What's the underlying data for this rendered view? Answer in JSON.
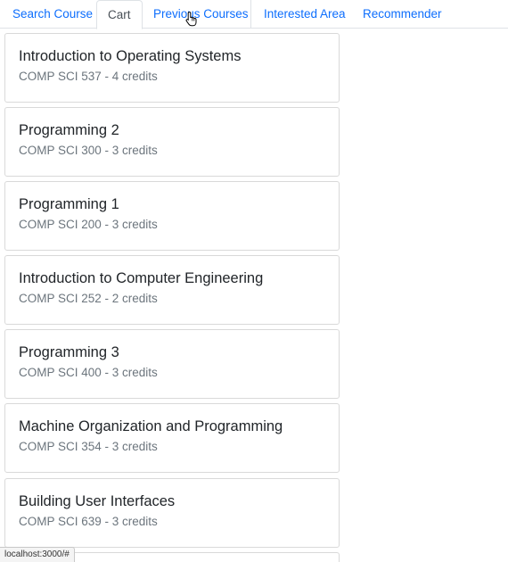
{
  "nav": {
    "tabs": [
      {
        "label": "Search Course"
      },
      {
        "label": "Cart"
      },
      {
        "label": "Previous Courses"
      },
      {
        "label": "Interested Area"
      },
      {
        "label": "Recommender"
      }
    ],
    "active_tab": "Cart"
  },
  "cart": {
    "courses": [
      {
        "name": "Introduction to Operating Systems",
        "details": "COMP SCI 537 - 4 credits"
      },
      {
        "name": "Programming 2",
        "details": "COMP SCI 300 - 3 credits"
      },
      {
        "name": "Programming 1",
        "details": "COMP SCI 200 - 3 credits"
      },
      {
        "name": "Introduction to Computer Engineering",
        "details": "COMP SCI 252 - 2 credits"
      },
      {
        "name": "Programming 3",
        "details": "COMP SCI 400 - 3 credits"
      },
      {
        "name": "Machine Organization and Programming",
        "details": "COMP SCI 354 - 3 credits"
      },
      {
        "name": "Building User Interfaces",
        "details": "COMP SCI 639 - 3 credits"
      }
    ]
  },
  "status_bar": {
    "url": "localhost:3000/#"
  },
  "colors": {
    "link": "#0d6efd",
    "active_tab_text": "#495057",
    "muted": "#6c757d",
    "border": "#dee2e6"
  },
  "icons": {
    "cursor": "hand-pointer-icon"
  }
}
